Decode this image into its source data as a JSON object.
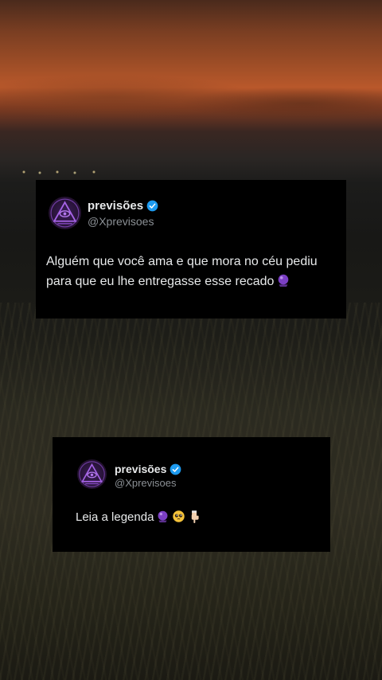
{
  "tweets": [
    {
      "name": "previsões",
      "handle": "@Xprevisoes",
      "text": "Alguém que você ama e que mora no céu pediu para que eu lhe entregasse esse recado",
      "emojis": [
        "crystal-ball-icon"
      ]
    },
    {
      "name": "previsões",
      "handle": "@Xprevisoes",
      "text": "Leia a legenda",
      "emojis": [
        "crystal-ball-icon",
        "pleading-face-icon",
        "pointing-down-icon"
      ]
    }
  ],
  "colors": {
    "card_bg": "#000000",
    "text": "#e7e9ea",
    "handle": "#8b9095",
    "verified": "#1d9bf0",
    "avatar_accent": "#8f4fd1"
  }
}
